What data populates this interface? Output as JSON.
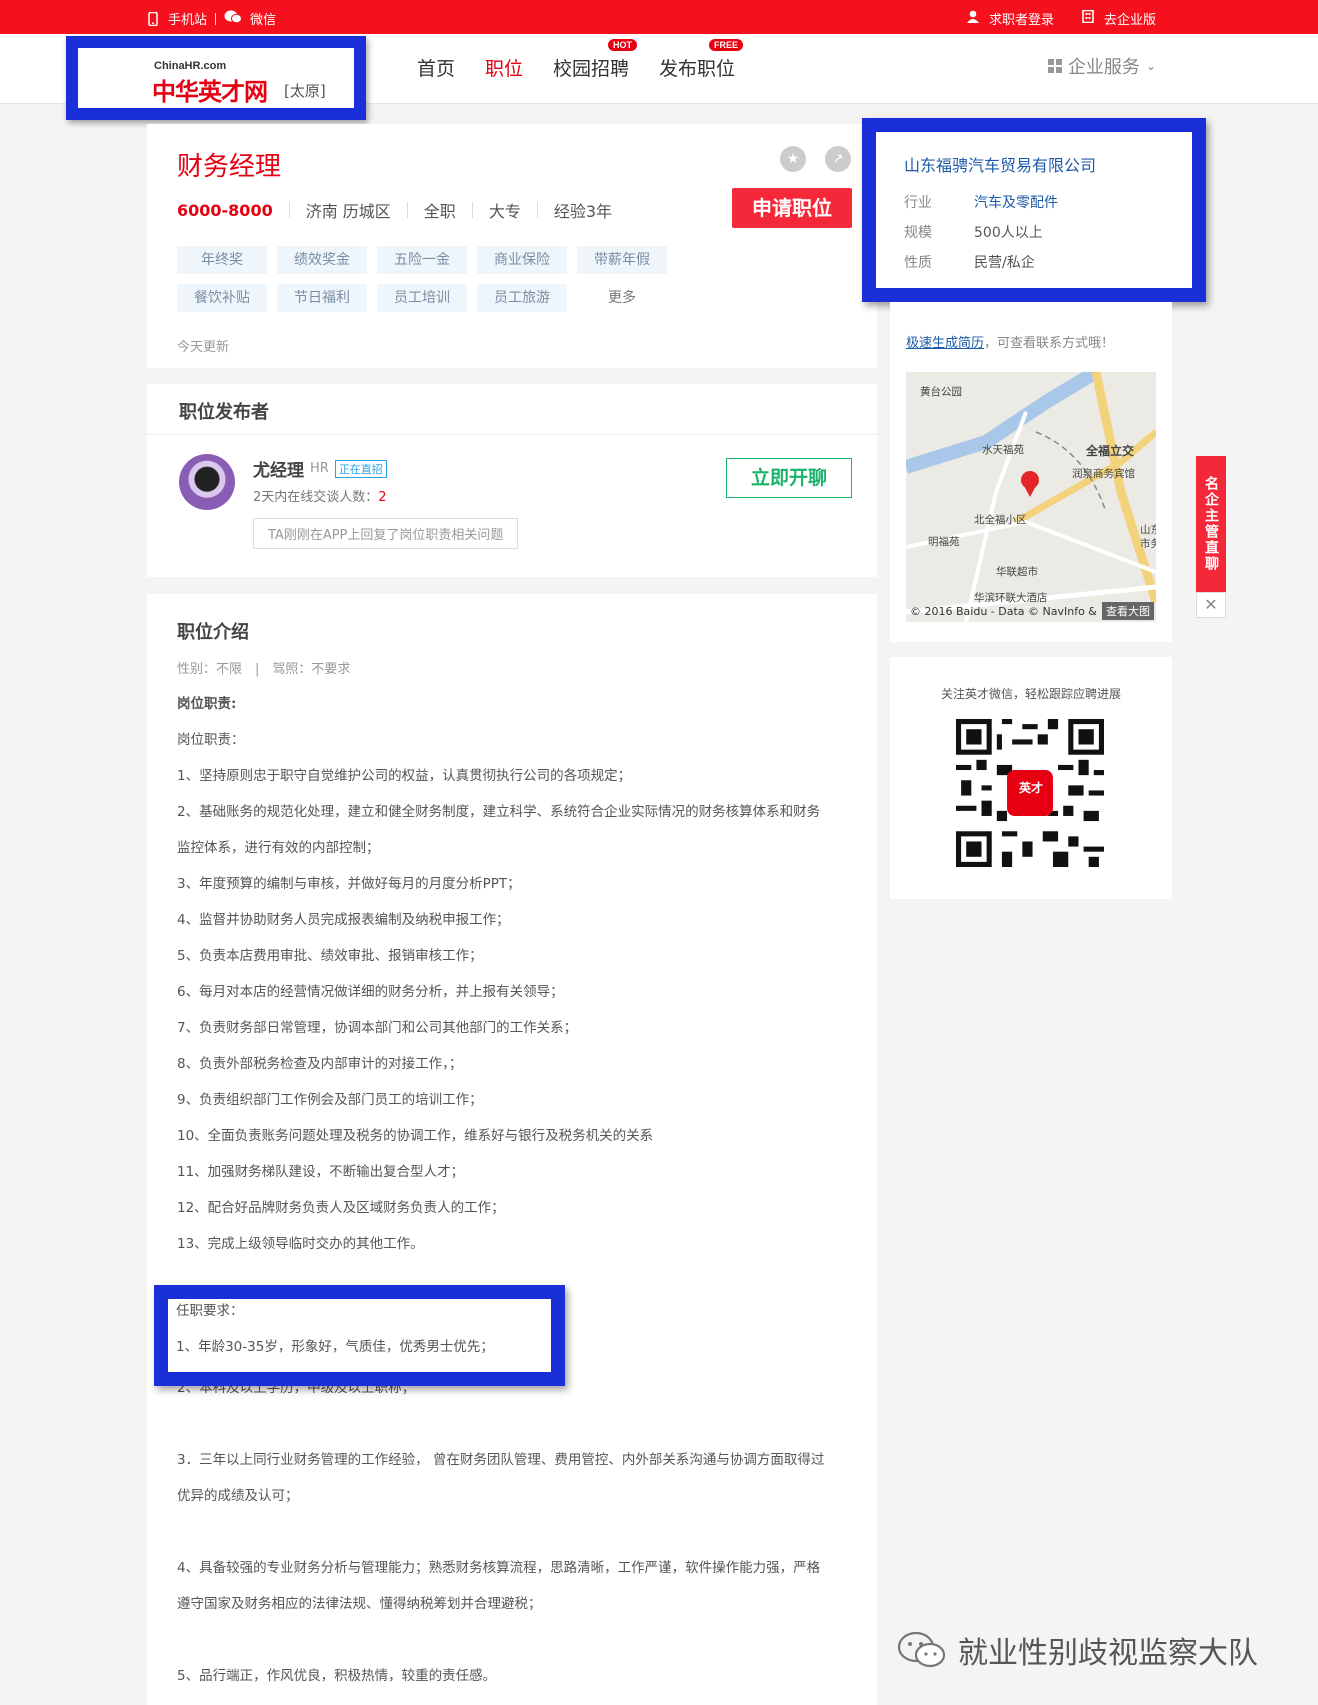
{
  "topbar": {
    "mobile": "手机站",
    "wechat": "微信",
    "login": "求职者登录",
    "enterprise": "去企业版"
  },
  "header": {
    "logo_small": "ChinaHR.com",
    "logo_main": "中华英才网",
    "city": "[太原]",
    "nav": [
      {
        "label": "首页"
      },
      {
        "label": "职位"
      },
      {
        "label": "校园招聘",
        "badge": "HOT"
      },
      {
        "label": "发布职位",
        "badge": "FREE"
      }
    ],
    "enterprise_service": "企业服务"
  },
  "job": {
    "title": "财务经理",
    "salary": "6000-8000",
    "location": "济南 历城区",
    "type": "全职",
    "education": "大专",
    "experience": "经验3年",
    "apply": "申请职位",
    "tags": [
      "年终奖",
      "绩效奖金",
      "五险一金",
      "商业保险",
      "带薪年假",
      "餐饮补贴",
      "节日福利",
      "员工培训",
      "员工旅游",
      "更多"
    ],
    "updated": "今天更新"
  },
  "company": {
    "name": "山东福骋汽车贸易有限公司",
    "rows": [
      {
        "k": "行业",
        "v": "汽车及零配件"
      },
      {
        "k": "规模",
        "v": "500人以上"
      },
      {
        "k": "性质",
        "v": "民营/私企"
      }
    ]
  },
  "side": {
    "resume_link": "极速生成简历",
    "resume_tail": "，可查看联系方式哦！",
    "map_labels": [
      "黄台公园",
      "水天福苑",
      "全福立交",
      "润泉商务宾馆",
      "北全福小区",
      "明福苑",
      "华联超市",
      "华滨环联大酒店",
      "山东",
      "市务"
    ],
    "map_footer": "© 2016 Baidu - Data © NavInfo &",
    "map_view": "查看大图",
    "qr_text": "关注英才微信，轻松跟踪应聘进展",
    "qr_center": "英才"
  },
  "float": {
    "tab": "名企主管直聊",
    "close": "✕"
  },
  "publisher": {
    "title": "职位发布者",
    "name": "尤经理",
    "role": "HR",
    "badge": "正在直招",
    "count_label": "2天内在线交谈人数：",
    "count": "2",
    "note": "TA刚刚在APP上回复了岗位职责相关问题",
    "chat": "立即开聊"
  },
  "desc": {
    "title": "职位介绍",
    "sub": "性别：不限　|　驾照：不要求",
    "duty_title": "岗位职责:",
    "lines": [
      "岗位职责：",
      "1、坚持原则忠于职守自觉维护公司的权益，认真贯彻执行公司的各项规定；",
      "2、基础账务的规范化处理，建立和健全财务制度，建立科学、系统符合企业实际情况的财务核算体系和财务",
      "监控体系，进行有效的内部控制；",
      "3、年度预算的编制与审核，并做好每月的月度分析PPT；",
      "4、监督并协助财务人员完成报表编制及纳税申报工作；",
      "5、负责本店费用审批、绩效审批、报销审核工作；",
      "6、每月对本店的经营情况做详细的财务分析，并上报有关领导；",
      "7、负责财务部日常管理，协调本部门和公司其他部门的工作关系；",
      "8、负责外部税务检查及内部审计的对接工作，；",
      "9、负责组织部门工作例会及部门员工的培训工作；",
      "10、全面负责账务问题处理及税务的协调工作，维系好与银行及税务机关的关系",
      "11、加强财务梯队建设，不断输出复合型人才；",
      "12、配合好品牌财务负责人及区域财务负责人的工作；",
      "13、完成上级领导临时交办的其他工作。"
    ],
    "req_title": "任职要求：",
    "req_1": "1、年龄30-35岁，形象好，气质佳，优秀男士优先；",
    "req_lines": [
      "2、本科及以上学历，中级及以上职称；",
      "",
      "3．三年以上同行业财务管理的工作经验，  曾在财务团队管理、费用管控、内外部关系沟通与协调方面取得过",
      "优异的成绩及认可；",
      "",
      "4、具备较强的专业财务分析与管理能力；熟悉财务核算流程，思路清晰，工作严谨，软件操作能力强，严格",
      "遵守国家及财务相应的法律法规、懂得纳税筹划并合理避税；",
      "",
      "5、品行端正，作风优良，积极热情，较重的责任感。"
    ]
  },
  "watermark": "就业性别歧视监察大队"
}
